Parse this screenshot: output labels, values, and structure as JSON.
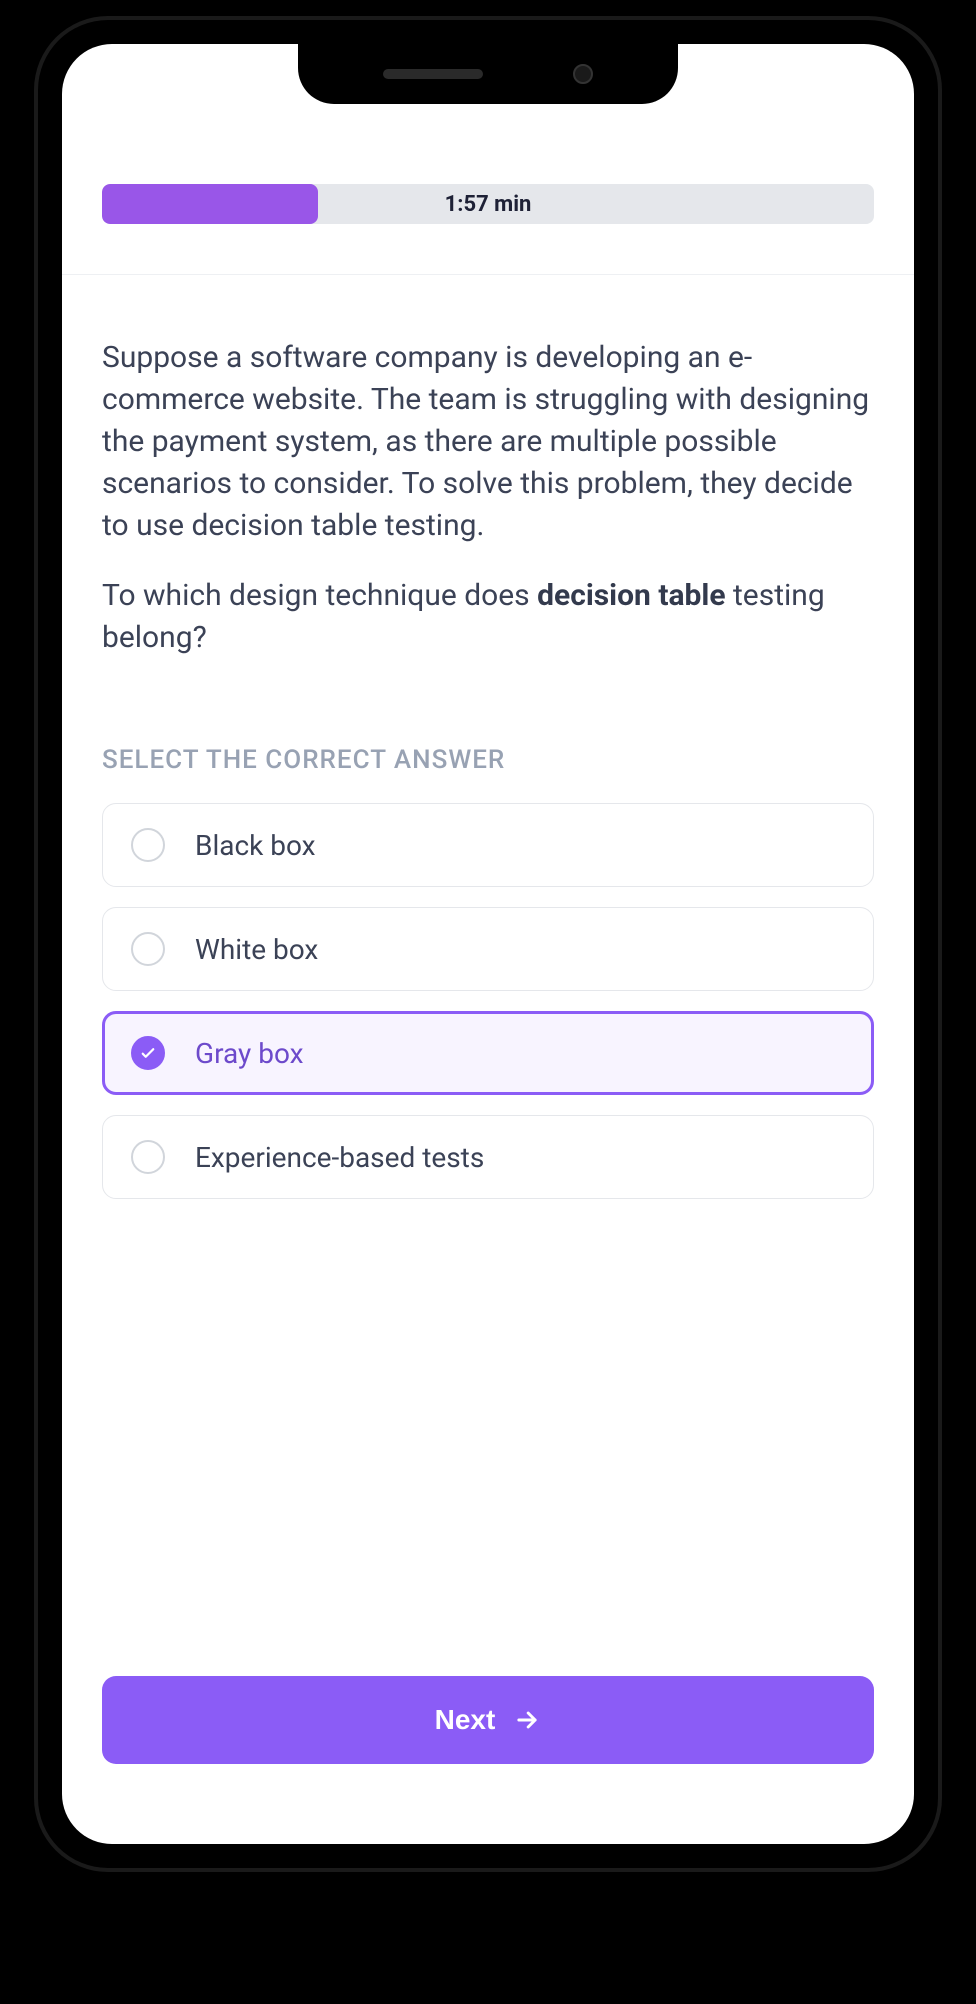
{
  "timer": {
    "label": "1:57 min",
    "progress_pct": 28
  },
  "question": {
    "paragraph1": "Suppose a software company is developing an e-commerce website. The team is struggling with designing the payment system, as there are multiple possible scenarios to consider. To solve this problem, they decide to use decision table testing.",
    "p2_prefix": "To which design technique does ",
    "p2_bold": "decision table",
    "p2_suffix": " testing belong?"
  },
  "instruction": "SELECT THE CORRECT ANSWER",
  "options": [
    {
      "label": "Black box",
      "selected": false
    },
    {
      "label": "White box",
      "selected": false
    },
    {
      "label": "Gray box",
      "selected": true
    },
    {
      "label": "Experience-based tests",
      "selected": false
    }
  ],
  "next_button": {
    "label": "Next"
  }
}
